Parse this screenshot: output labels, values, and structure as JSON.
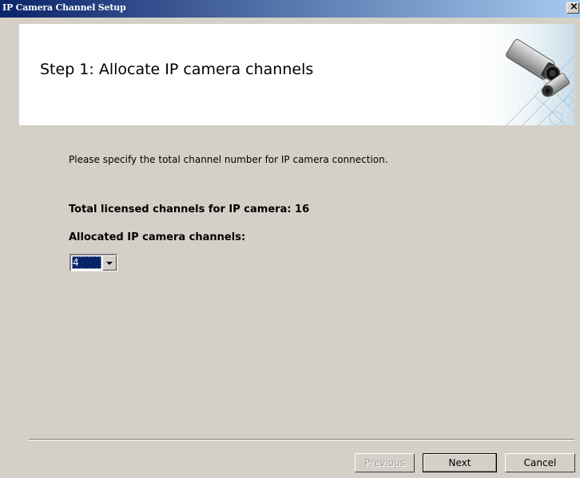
{
  "window": {
    "title": "IP Camera Channel Setup",
    "close_glyph": "×"
  },
  "header": {
    "step_title": "Step 1: Allocate IP camera channels",
    "illustration": "ip-camera-illustration"
  },
  "content": {
    "instruction": "Please specify the total channel number for IP camera connection.",
    "licensed_text": "Total licensed channels for IP camera: 16",
    "allocated_label": "Allocated IP camera channels:",
    "allocated_value": "4"
  },
  "buttons": {
    "previous": "Previous",
    "next": "Next",
    "cancel": "Cancel"
  },
  "colors": {
    "titlebar_start": "#0a246a",
    "titlebar_end": "#a6caf0",
    "dialog_bg": "#d4d0c8",
    "selection": "#0a246a"
  }
}
